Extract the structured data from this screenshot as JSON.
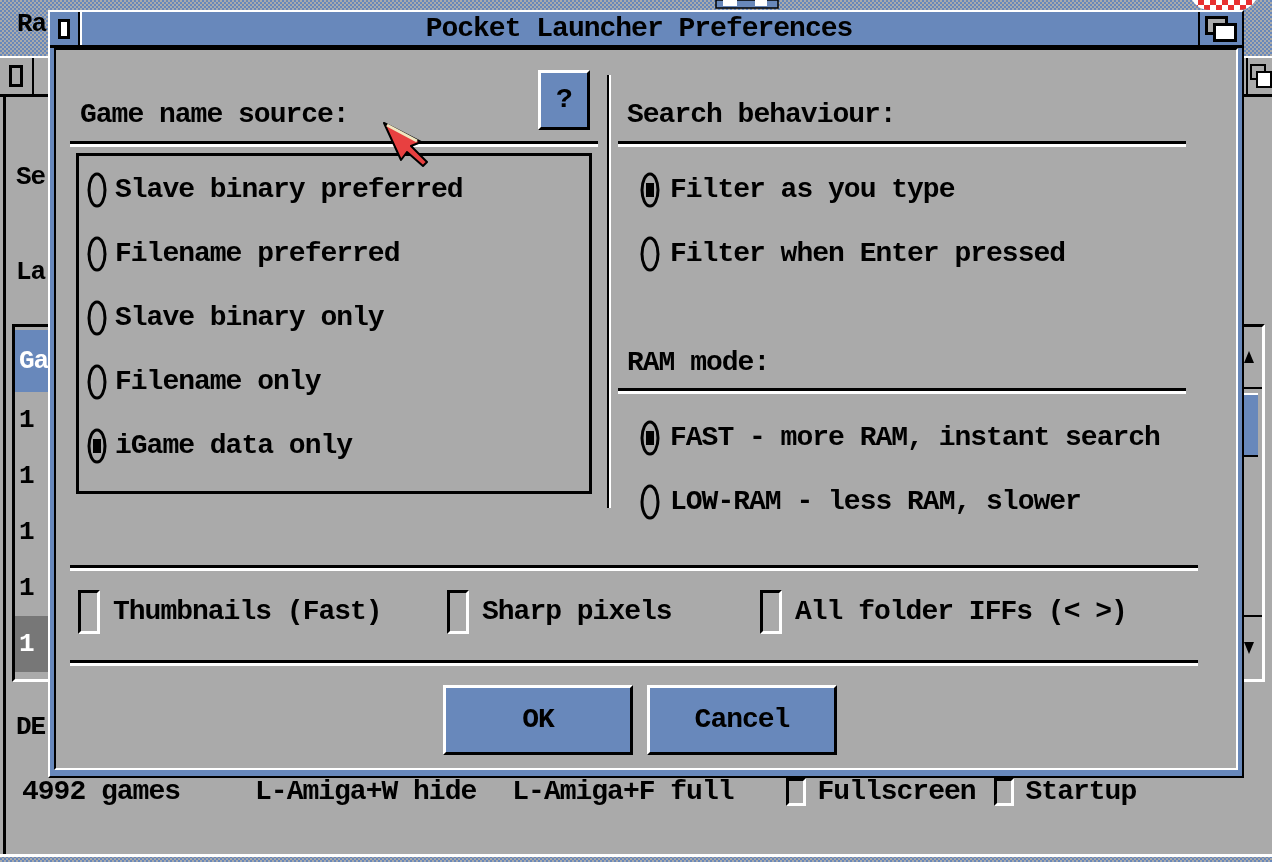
{
  "screen": {
    "title": "Ra"
  },
  "background_window": {
    "labels": [
      "Se",
      "La"
    ],
    "list": {
      "header": "Ga",
      "rows": [
        {
          "text": "1",
          "selected": false
        },
        {
          "text": "1",
          "selected": false
        },
        {
          "text": "1",
          "selected": false
        },
        {
          "text": "1",
          "selected": false
        },
        {
          "text": "1",
          "selected": true
        }
      ]
    },
    "footer_label": "DE",
    "status": {
      "count": "4992 games",
      "hints": [
        "L-Amiga+W hide",
        "L-Amiga+F full"
      ],
      "checkboxes": [
        {
          "label": "Fullscreen",
          "checked": false
        },
        {
          "label": "Startup",
          "checked": false
        }
      ]
    }
  },
  "dialog": {
    "title": "Pocket Launcher Preferences",
    "help_button": "?",
    "game_name_source": {
      "label": "Game name source:",
      "options": [
        {
          "label": "Slave binary preferred",
          "selected": false
        },
        {
          "label": "Filename preferred",
          "selected": false
        },
        {
          "label": "Slave binary only",
          "selected": false
        },
        {
          "label": "Filename only",
          "selected": false
        },
        {
          "label": "iGame data only",
          "selected": true
        }
      ]
    },
    "search_behaviour": {
      "label": "Search behaviour:",
      "options": [
        {
          "label": "Filter as you type",
          "selected": true
        },
        {
          "label": "Filter when Enter pressed",
          "selected": false
        }
      ]
    },
    "ram_mode": {
      "label": "RAM mode:",
      "options": [
        {
          "label": "FAST - more RAM, instant search",
          "selected": true
        },
        {
          "label": "LOW-RAM - less RAM, slower",
          "selected": false
        }
      ]
    },
    "checkboxes": [
      {
        "label": "Thumbnails (Fast)",
        "checked": false
      },
      {
        "label": "Sharp pixels",
        "checked": false
      },
      {
        "label": "All folder IFFs (< >)",
        "checked": false
      }
    ],
    "buttons": [
      "OK",
      "Cancel"
    ]
  }
}
